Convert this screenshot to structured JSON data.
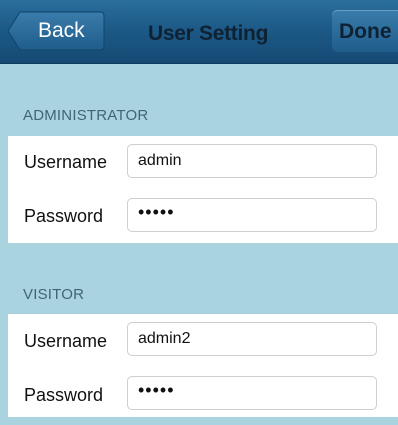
{
  "navbar": {
    "back_label": "Back",
    "title": "User Setting",
    "done_label": "Done"
  },
  "administrator": {
    "header": "ADMINISTRATOR",
    "username_label": "Username",
    "username_value": "admin",
    "password_label": "Password",
    "password_value": "•••••"
  },
  "visitor": {
    "header": "VISITOR",
    "username_label": "Username",
    "username_value": "admin2",
    "password_label": "Password",
    "password_value": "•••••"
  },
  "colors": {
    "navbar": "#1d5a87",
    "section_background": "#a9d3df",
    "section_header_text": "#3f6675"
  }
}
